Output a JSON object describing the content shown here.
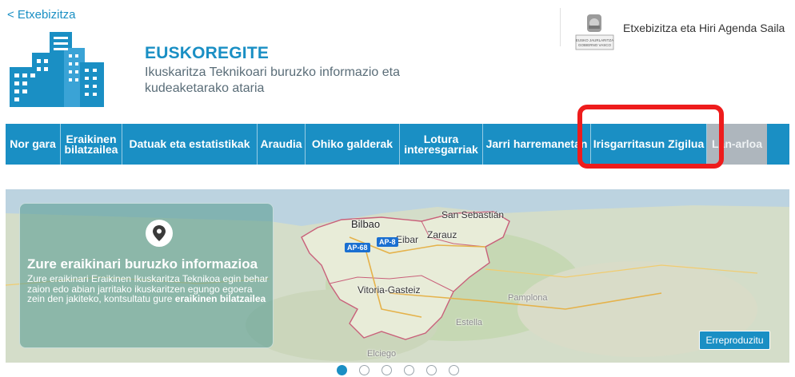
{
  "header": {
    "back_link": "< Etxebizitza",
    "title": "EUSKOREGITE",
    "subtitle": "Ikuskaritza Teknikoari buruzko informazio eta kudeaketarako ataria",
    "department": "Etxebizitza eta Hiri Agenda Saila",
    "seal_text": "EUSKO JAURLARITZA GOBIERNO VASCO"
  },
  "nav": {
    "items": [
      {
        "label": "Nor gara"
      },
      {
        "label": "Eraikinen\nbilatzailea"
      },
      {
        "label": "Datuak eta estatistikak"
      },
      {
        "label": "Araudia"
      },
      {
        "label": "Ohiko galderak"
      },
      {
        "label": "Lotura\ninteresgarriak"
      },
      {
        "label": "Jarri harremanetan"
      },
      {
        "label": "Irisgarritasun Zigilua"
      },
      {
        "label": "Lan-arloa"
      }
    ]
  },
  "banner": {
    "info_title": "Zure eraikinari buruzko informazioa",
    "info_body": "Zure eraikinari Eraikinen Ikuskaritza Teknikoa egin behar zaion edo abian jarritako ikuskaritzen egungo egoera zein den jakiteko, kontsultatu gure",
    "info_link": "eraikinen bilatzailea",
    "play_button": "Erreproduzitu",
    "map_labels": {
      "bilbao": "Bilbao",
      "donostia": "San Sebastián",
      "zarautz": "Zarauz",
      "eibar": "Eibar",
      "vitoria": "Vitoria-Gasteiz",
      "elciego": "Elciego",
      "pamplona": "Pamplona",
      "estella": "Estella",
      "road1": "AP-68",
      "road2": "AP-8"
    }
  },
  "carousel": {
    "slide_count": 6,
    "active_index": 0
  },
  "colors": {
    "brand_blue": "#1a8fc4",
    "highlight_red": "#ee1c1c",
    "nav_inactive_gray": "#aeb6bd"
  }
}
